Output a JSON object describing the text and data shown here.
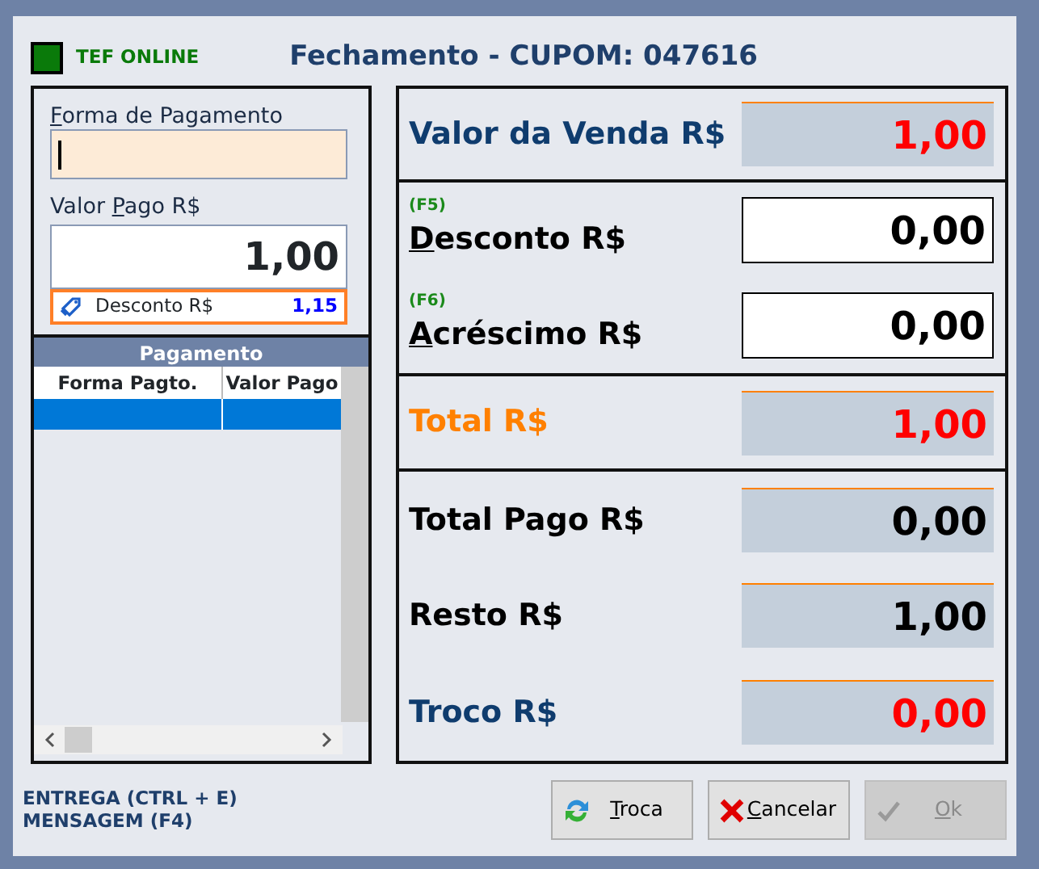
{
  "header": {
    "tef_status": {
      "label": "TEF ONLINE",
      "online": true
    },
    "title": "Fechamento - CUPOM: 047616"
  },
  "payment_entry": {
    "method_field": {
      "label": [
        {
          "text": "F",
          "underline": true
        },
        {
          "text": "orma de Pagamento",
          "underline": false
        }
      ],
      "focused": true
    },
    "amount_field": {
      "label": [
        {
          "text": "Valor ",
          "underline": false
        },
        {
          "text": "P",
          "underline": true
        },
        {
          "text": "ago R$",
          "underline": false
        }
      ],
      "value": "1,00"
    },
    "discount_chip": {
      "label": "Desconto R$",
      "value": "1,15"
    }
  },
  "payments_grid": {
    "title": "Pagamento",
    "columns": [
      "Forma Pagto.",
      "Valor Pago"
    ],
    "rows": [
      {
        "selected": true
      }
    ]
  },
  "summary": [
    {
      "rows": [
        {
          "kind": "sale",
          "label": [
            {
              "text": "Valor da Venda R$",
              "underline": false
            }
          ],
          "value": "1,00"
        }
      ]
    },
    {
      "rows": [
        {
          "kind": "input",
          "hotkey": "(F5)",
          "label": [
            {
              "text": "D",
              "underline": true
            },
            {
              "text": "esconto R$",
              "underline": false
            }
          ],
          "value": "0,00"
        },
        {
          "kind": "input",
          "hotkey": "(F6)",
          "label": [
            {
              "text": "A",
              "underline": true
            },
            {
              "text": "créscimo R$",
              "underline": false
            }
          ],
          "value": "0,00"
        }
      ]
    },
    {
      "rows": [
        {
          "kind": "total",
          "label": [
            {
              "text": "Total R$",
              "underline": false
            }
          ],
          "value": "1,00"
        }
      ]
    },
    {
      "rows": [
        {
          "kind": "plain",
          "label": [
            {
              "text": "Total Pago R$",
              "underline": false
            }
          ],
          "value": "0,00"
        },
        {
          "kind": "plain",
          "label": [
            {
              "text": "Resto R$",
              "underline": false
            }
          ],
          "value": "1,00"
        },
        {
          "kind": "change",
          "label": [
            {
              "text": "Troco R$",
              "underline": false
            }
          ],
          "value": "0,00"
        }
      ]
    }
  ],
  "shortcuts": [
    "ENTREGA (CTRL + E)",
    "MENSAGEM (F4)"
  ],
  "buttons": [
    {
      "kind": "exchange",
      "label": [
        {
          "text": "T",
          "underline": true
        },
        {
          "text": "roca",
          "underline": false
        }
      ],
      "disabled": false
    },
    {
      "kind": "cancel",
      "label": [
        {
          "text": "C",
          "underline": true
        },
        {
          "text": "ancelar",
          "underline": false
        }
      ],
      "disabled": false
    },
    {
      "kind": "ok",
      "label": [
        {
          "text": "O",
          "underline": true
        },
        {
          "text": "k",
          "underline": false
        }
      ],
      "disabled": true
    }
  ]
}
